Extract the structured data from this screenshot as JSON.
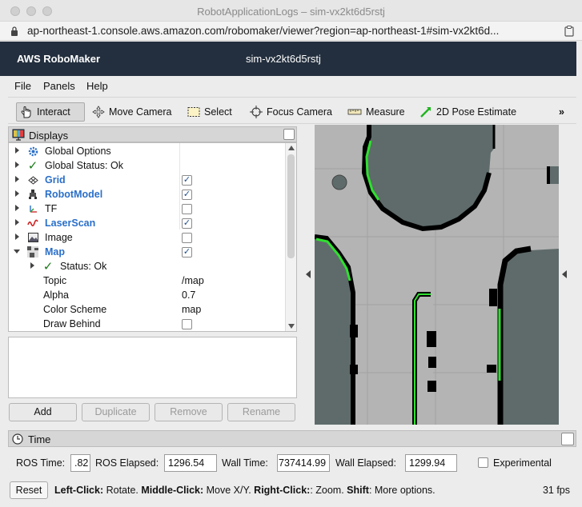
{
  "window": {
    "title": "RobotApplicationLogs – sim-vx2kt6d5rstj",
    "url": "ap-northeast-1.console.aws.amazon.com/robomaker/viewer?region=ap-northeast-1#sim-vx2kt6d..."
  },
  "aws": {
    "brand": "AWS RoboMaker",
    "simulation": "sim-vx2kt6d5rstj"
  },
  "menu": {
    "file": "File",
    "panels": "Panels",
    "help": "Help"
  },
  "toolbar": {
    "interact": "Interact",
    "move_camera": "Move Camera",
    "select": "Select",
    "focus_camera": "Focus Camera",
    "measure": "Measure",
    "pose_estimate": "2D Pose Estimate",
    "overflow": "»"
  },
  "displays": {
    "title": "Displays",
    "rows": [
      {
        "label": "Global Options"
      },
      {
        "label": "Global Status: Ok"
      },
      {
        "label": "Grid"
      },
      {
        "label": "RobotModel"
      },
      {
        "label": "TF"
      },
      {
        "label": "LaserScan"
      },
      {
        "label": "Image"
      },
      {
        "label": "Map"
      },
      {
        "label": "Status: Ok"
      },
      {
        "label": "Topic",
        "value": "/map"
      },
      {
        "label": "Alpha",
        "value": "0.7"
      },
      {
        "label": "Color Scheme",
        "value": "map"
      },
      {
        "label": "Draw Behind"
      }
    ],
    "check_mark": "✓",
    "buttons": {
      "add": "Add",
      "duplicate": "Duplicate",
      "remove": "Remove",
      "rename": "Rename"
    }
  },
  "time": {
    "title": "Time",
    "ros_time_label": "ROS Time:",
    "ros_time_value": ".82",
    "ros_elapsed_label": "ROS Elapsed:",
    "ros_elapsed_value": "1296.54",
    "wall_time_label": "Wall Time:",
    "wall_time_value": "737414.99",
    "wall_elapsed_label": "Wall Elapsed:",
    "wall_elapsed_value": "1299.94",
    "experimental_label": "Experimental"
  },
  "status": {
    "reset": "Reset",
    "hint": {
      "left_key": "Left-Click:",
      "left_text": " Rotate. ",
      "middle_key": "Middle-Click:",
      "middle_text": " Move X/Y. ",
      "right_key": "Right-Click:",
      "right_text": ": Zoom. ",
      "shift_key": "Shift",
      "shift_text": ": More options."
    },
    "fps": "31 fps"
  },
  "colors": {
    "aws_header": "#232f3e",
    "link_blue": "#2a6fc9",
    "map_occupied": "#5f6b6b",
    "map_free": "#b4b4b4",
    "laser": "#2fe02f"
  }
}
